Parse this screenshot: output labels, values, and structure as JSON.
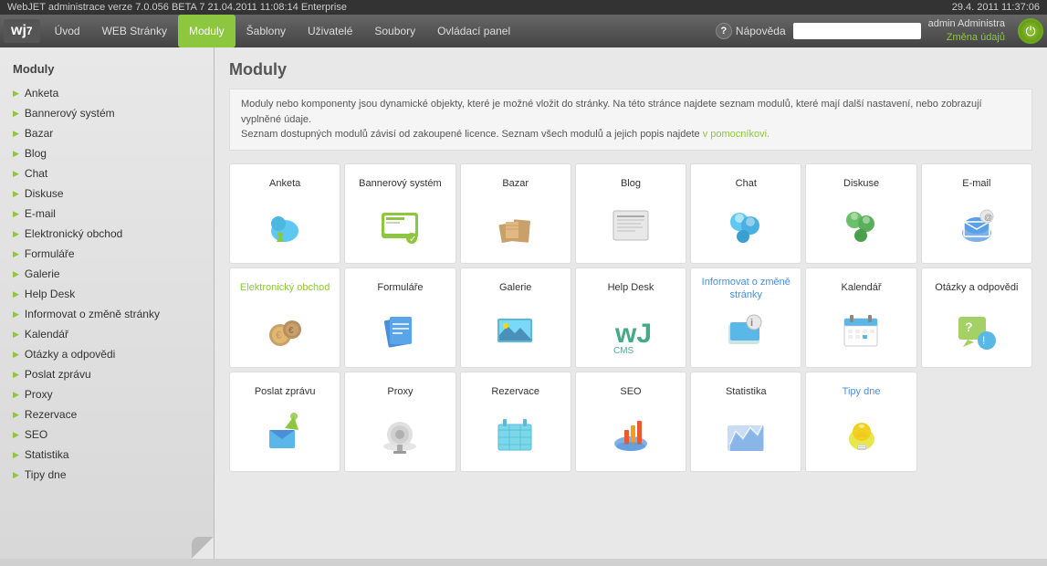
{
  "topbar": {
    "left": "WebJET administrace verze 7.0.056 BETA 7 21.04.2011 11:08:14 Enterprise",
    "right": "29.4. 2011 11:37:06"
  },
  "navbar": {
    "logo": "wj7",
    "items": [
      {
        "label": "Úvod",
        "active": false
      },
      {
        "label": "WEB Stránky",
        "active": false
      },
      {
        "label": "Moduly",
        "active": true
      },
      {
        "label": "Šablony",
        "active": false
      },
      {
        "label": "Uživatelé",
        "active": false
      },
      {
        "label": "Soubory",
        "active": false
      },
      {
        "label": "Ovládací panel",
        "active": false
      }
    ],
    "help_label": "Nápověda",
    "search_placeholder": "",
    "user_name": "admin Administra",
    "user_action": "Změna údajů"
  },
  "sidebar": {
    "heading": "Moduly",
    "items": [
      "Anketa",
      "Bannerový systém",
      "Bazar",
      "Blog",
      "Chat",
      "Diskuse",
      "E-mail",
      "Elektronický obchod",
      "Formuláře",
      "Galerie",
      "Help Desk",
      "Informovat o změně stránky",
      "Kalendář",
      "Otázky a odpovědi",
      "Poslat zprávu",
      "Proxy",
      "Rezervace",
      "SEO",
      "Statistika",
      "Tipy dne"
    ]
  },
  "content": {
    "title": "Moduly",
    "intro_text": "Moduly nebo komponenty jsou dynamické objekty, které je možné vložit do stránky. Na této stránce najdete seznam modulů, které mají další nastavení, nebo zobrazují vyplněné údaje.",
    "intro_text2": "Seznam dostupných modulů závisí od zakoupené licence. Seznam všech modulů a jejich popis najdete",
    "intro_link": "v pomocníkovi.",
    "modules": [
      {
        "label": "Anketa",
        "color": "normal",
        "icon": "anketa"
      },
      {
        "label": "Bannerový systém",
        "color": "normal",
        "icon": "banner"
      },
      {
        "label": "Bazar",
        "color": "normal",
        "icon": "bazar"
      },
      {
        "label": "Blog",
        "color": "normal",
        "icon": "blog"
      },
      {
        "label": "Chat",
        "color": "normal",
        "icon": "chat"
      },
      {
        "label": "Diskuse",
        "color": "normal",
        "icon": "diskuse"
      },
      {
        "label": "E-mail",
        "color": "normal",
        "icon": "email"
      },
      {
        "label": "Elektronický obchod",
        "color": "green",
        "icon": "eshop"
      },
      {
        "label": "Formuláře",
        "color": "normal",
        "icon": "formulare"
      },
      {
        "label": "Galerie",
        "color": "normal",
        "icon": "galerie"
      },
      {
        "label": "Help Desk",
        "color": "normal",
        "icon": "helpdesk"
      },
      {
        "label": "Informovat o změně stránky",
        "color": "blue",
        "icon": "informovat"
      },
      {
        "label": "Kalendář",
        "color": "normal",
        "icon": "kalendar"
      },
      {
        "label": "Otázky a odpovědi",
        "color": "normal",
        "icon": "otazky"
      },
      {
        "label": "Poslat zprávu",
        "color": "normal",
        "icon": "poslat"
      },
      {
        "label": "Proxy",
        "color": "normal",
        "icon": "proxy"
      },
      {
        "label": "Rezervace",
        "color": "normal",
        "icon": "rezervace"
      },
      {
        "label": "SEO",
        "color": "normal",
        "icon": "seo"
      },
      {
        "label": "Statistika",
        "color": "normal",
        "icon": "statistika"
      },
      {
        "label": "Tipy dne",
        "color": "blue",
        "icon": "tipy"
      }
    ]
  }
}
